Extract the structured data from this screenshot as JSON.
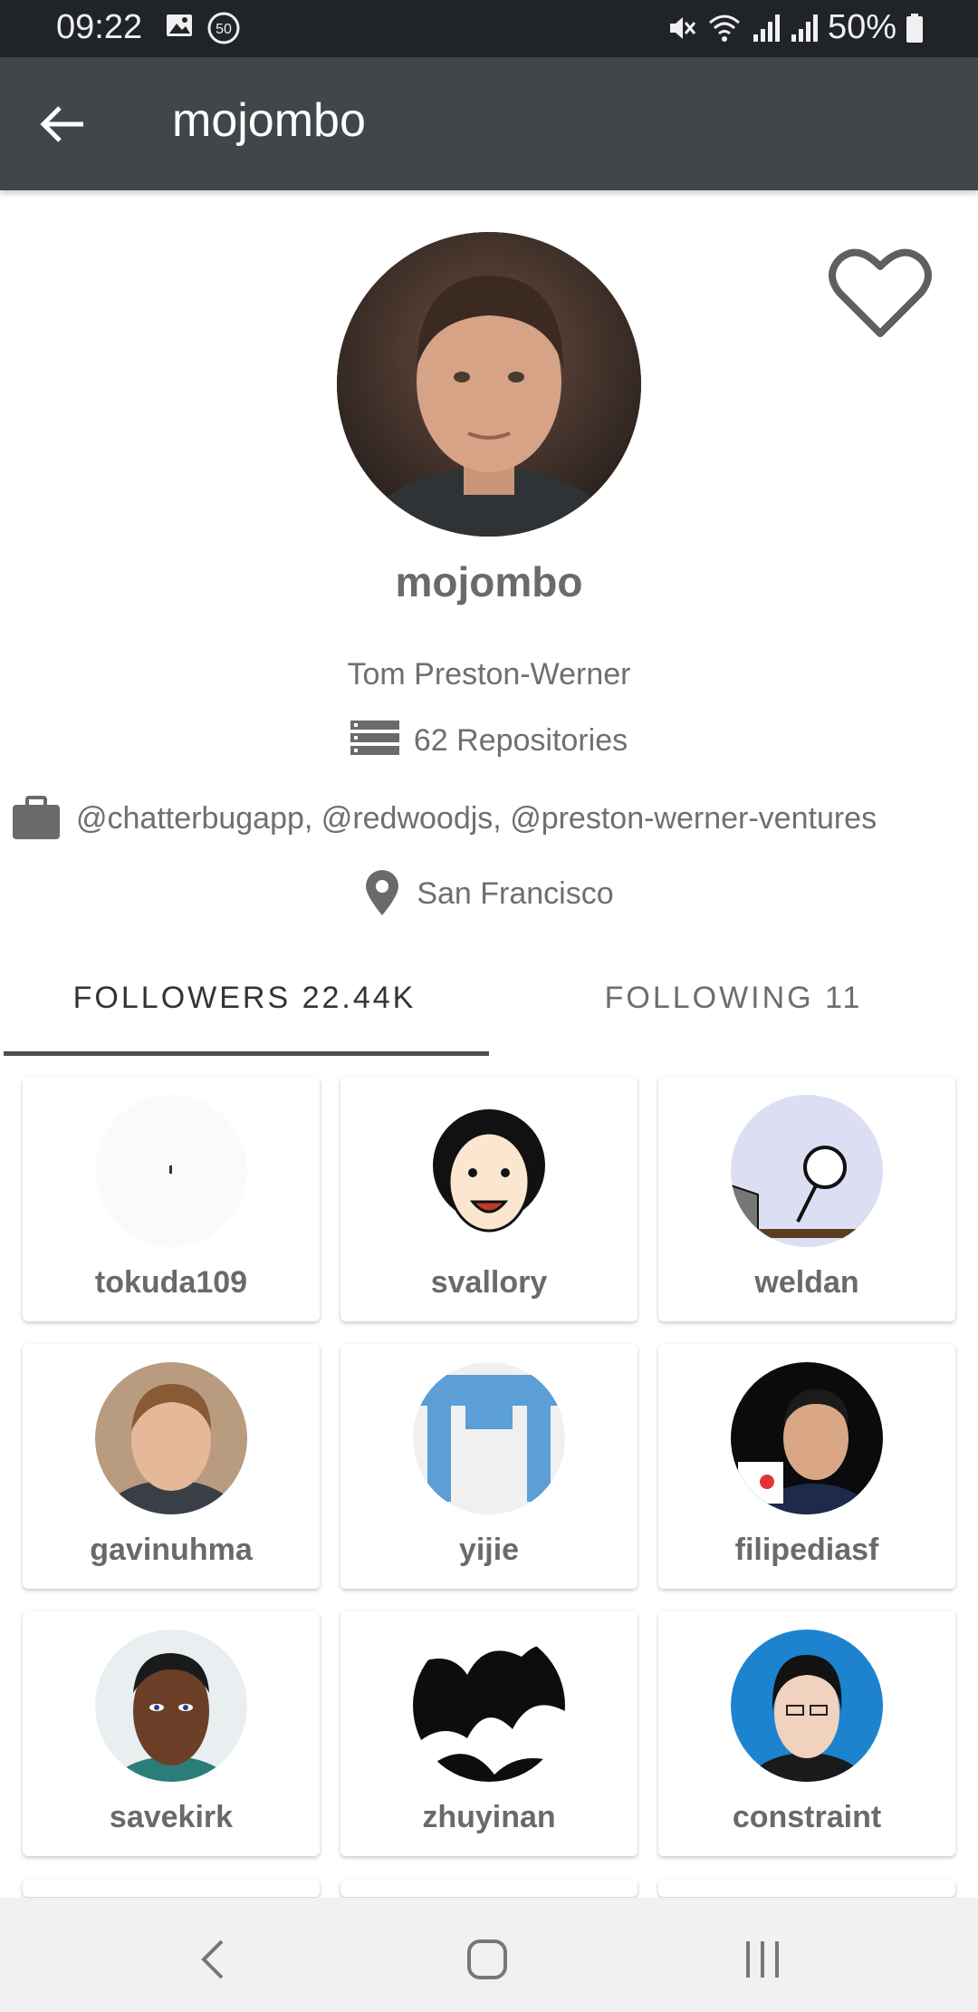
{
  "status_bar": {
    "time": "09:22",
    "notification_badge": "50",
    "battery": "50%",
    "icons": [
      "image-icon",
      "notification-count-icon",
      "mute-icon",
      "wifi-icon",
      "signal-icon",
      "signal-icon",
      "battery-icon"
    ]
  },
  "app_bar": {
    "title": "mojombo",
    "back_icon": "arrow-back-icon"
  },
  "profile": {
    "username": "mojombo",
    "full_name": "Tom Preston-Werner",
    "repositories": "62 Repositories",
    "company": "@chatterbugapp, @redwoodjs, @preston-werner-ventures",
    "location": "San Francisco",
    "favorite_icon": "heart-outline-icon"
  },
  "tabs": [
    {
      "label": "FOLLOWERS 22.44K",
      "selected": true
    },
    {
      "label": "FOLLOWING 11",
      "selected": false
    }
  ],
  "followers": [
    {
      "name": "tokuda109"
    },
    {
      "name": "svallory"
    },
    {
      "name": "weldan"
    },
    {
      "name": "gavinuhma"
    },
    {
      "name": "yijie"
    },
    {
      "name": "filipediasf"
    },
    {
      "name": "savekirk"
    },
    {
      "name": "zhuyinan"
    },
    {
      "name": "constraint"
    }
  ],
  "nav_bar": {
    "icons": [
      "nav-back-icon",
      "nav-home-icon",
      "nav-recents-icon"
    ]
  },
  "colors": {
    "status_bar": "#202327",
    "app_bar": "#41464a",
    "text_gray": "#6a6a6a",
    "nav_bar": "#f1f1f1"
  }
}
